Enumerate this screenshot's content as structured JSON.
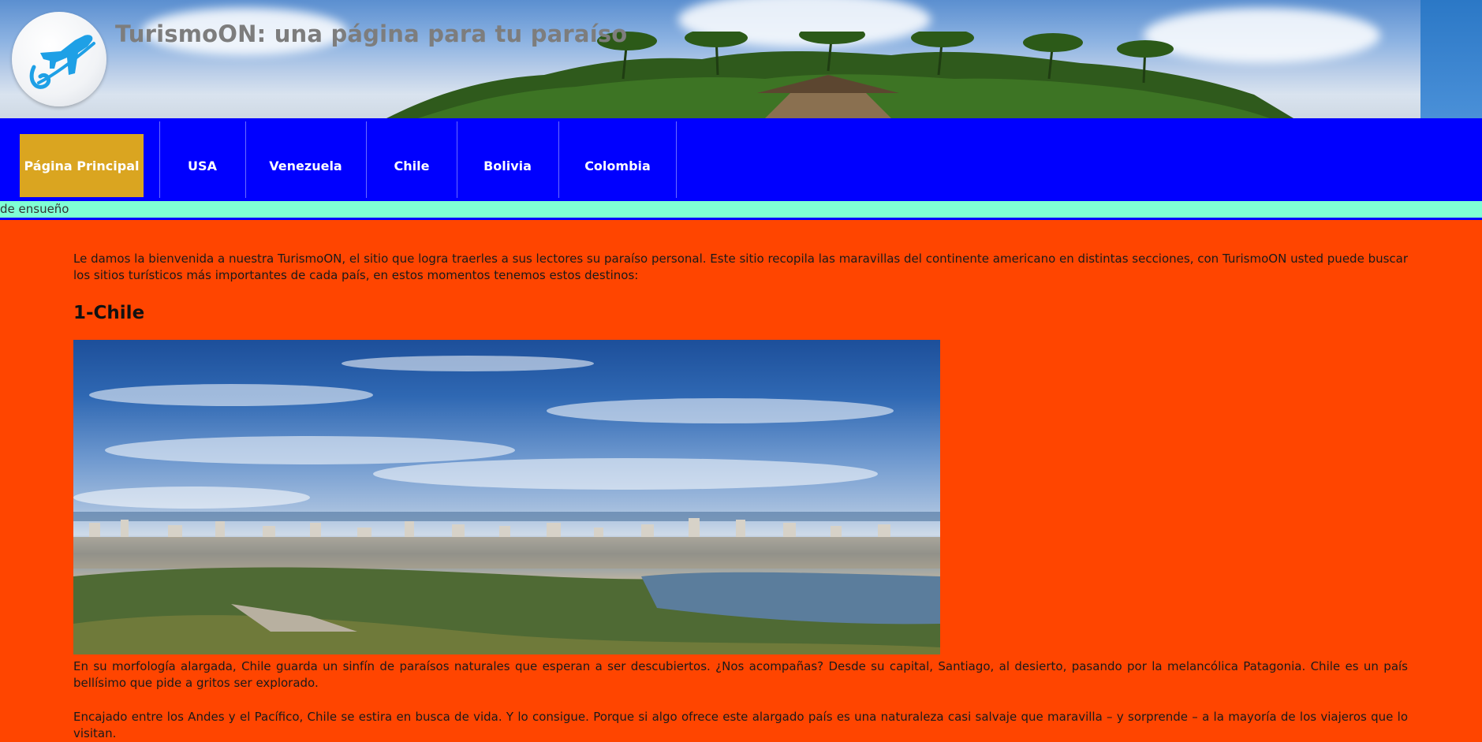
{
  "header": {
    "site_title": "TurismoON: una página para tu paraíso"
  },
  "nav": {
    "items": [
      {
        "label": "Página Principal",
        "active": true
      },
      {
        "label": "USA",
        "active": false
      },
      {
        "label": "Venezuela",
        "active": false
      },
      {
        "label": "Chile",
        "active": false
      },
      {
        "label": "Bolivia",
        "active": false
      },
      {
        "label": "Colombia",
        "active": false
      }
    ]
  },
  "ticker": {
    "text": "de ensueño"
  },
  "main": {
    "intro": "Le damos la bienvenida a nuestra TurismoON, el sitio que logra traerles a sus lectores su paraíso personal. Este sitio recopila las maravillas del continente americano en distintas secciones, con TurismoON usted puede buscar los sitios turísticos más importantes de cada país, en estos momentos tenemos estos destinos:",
    "section_title": "1-Chile",
    "paragraph_1": "En su morfología alargada, Chile guarda un sinfín de paraísos naturales que esperan a ser descubiertos. ¿Nos acompañas? Desde su capital, Santiago, al desierto, pasando por la melancólica Patagonia. Chile es un país bellísimo que pide a gritos ser explorado.",
    "paragraph_2": "Encajado entre los Andes y el Pacífico, Chile se estira en busca de vida. Y lo consigue. Porque si algo ofrece este alargado país es una naturaleza casi salvaje que maravilla – y sorprende – a la mayoría de los viajeros que lo visitan."
  },
  "colors": {
    "page_background": "#FF4500",
    "nav_background": "#0000FF",
    "nav_active": "#DAA520",
    "ticker_background": "#7FFFD4",
    "title_color": "#7d7d7d"
  },
  "icons": {
    "logo": "airplane-logo-icon"
  }
}
